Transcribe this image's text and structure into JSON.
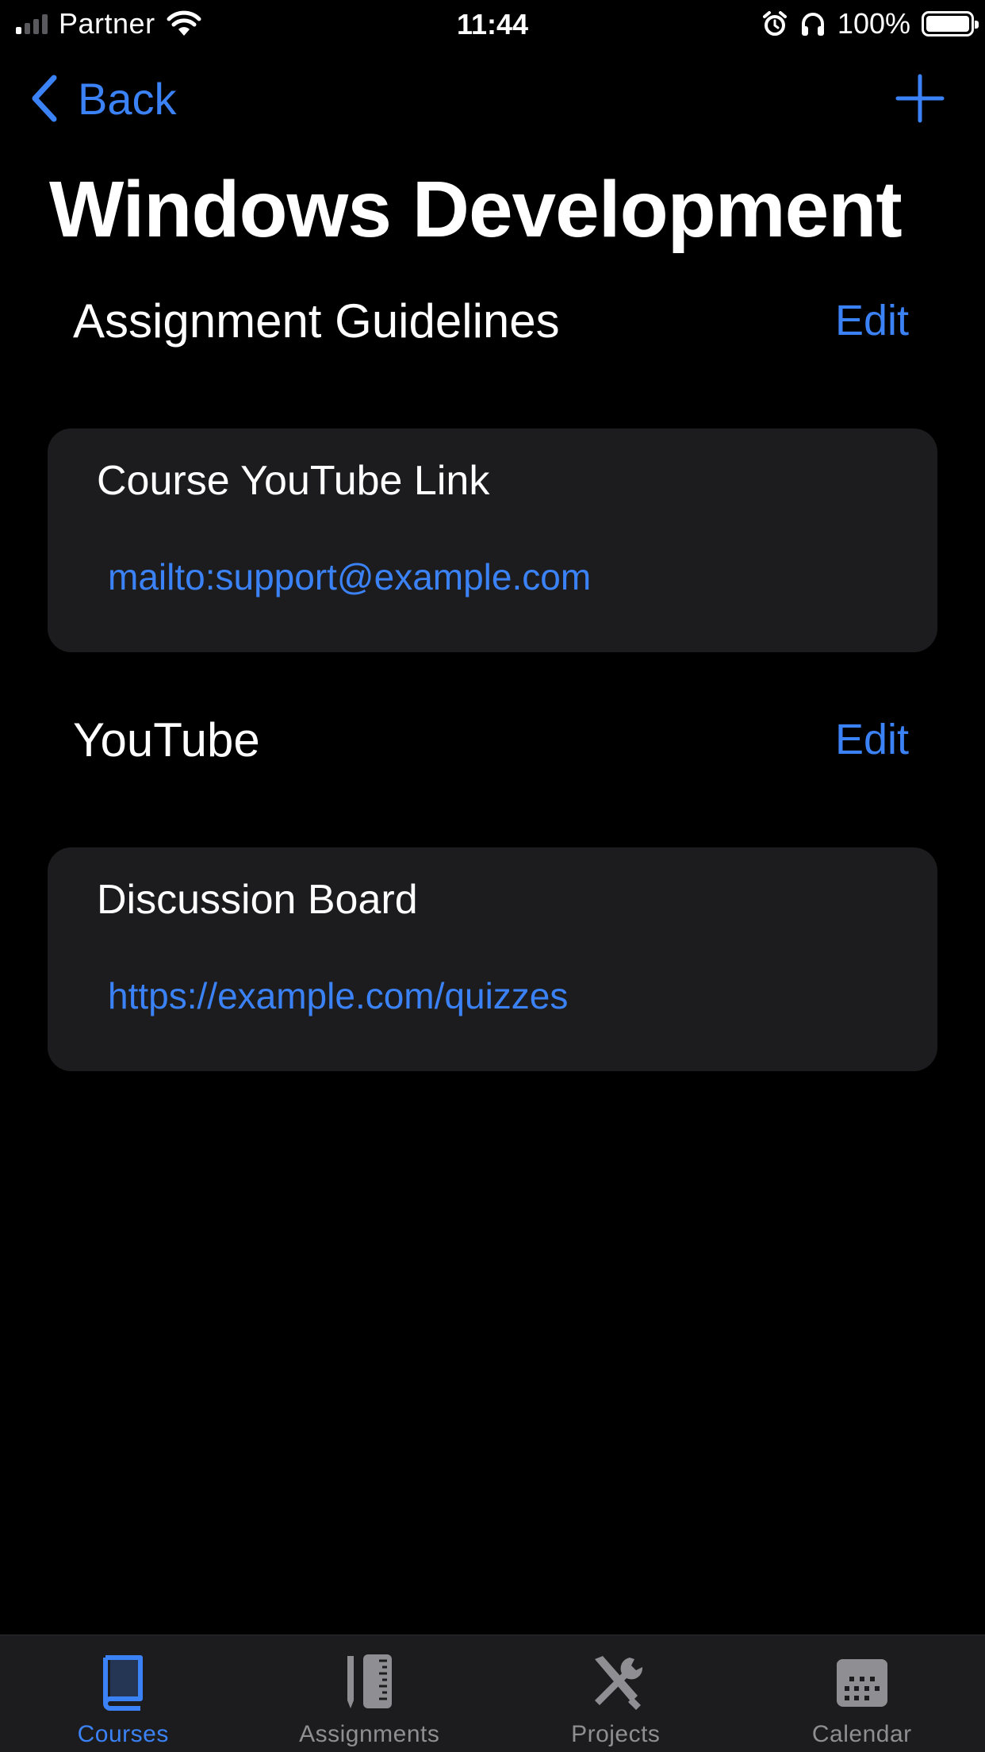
{
  "status_bar": {
    "carrier": "Partner",
    "time": "11:44",
    "battery_percent": "100%",
    "battery_level": 1.0
  },
  "nav": {
    "back_label": "Back",
    "add_icon": "plus-icon"
  },
  "page": {
    "title": "Windows Development"
  },
  "sections": [
    {
      "title": "Assignment Guidelines",
      "edit_label": "Edit",
      "card": {
        "title": "Course YouTube Link",
        "link": "mailto:support@example.com"
      }
    },
    {
      "title": "YouTube",
      "edit_label": "Edit",
      "card": {
        "title": "Discussion Board",
        "link": "https://example.com/quizzes"
      }
    }
  ],
  "tab_bar": {
    "items": [
      {
        "label": "Courses",
        "icon": "book-icon",
        "active": true
      },
      {
        "label": "Assignments",
        "icon": "pencil-ruler-icon",
        "active": false
      },
      {
        "label": "Projects",
        "icon": "tools-icon",
        "active": false
      },
      {
        "label": "Calendar",
        "icon": "calendar-icon",
        "active": false
      }
    ]
  },
  "colors": {
    "accent": "#3b82f6",
    "background": "#000000",
    "card": "#1c1c1e",
    "inactive_tab": "#8e8e93"
  }
}
